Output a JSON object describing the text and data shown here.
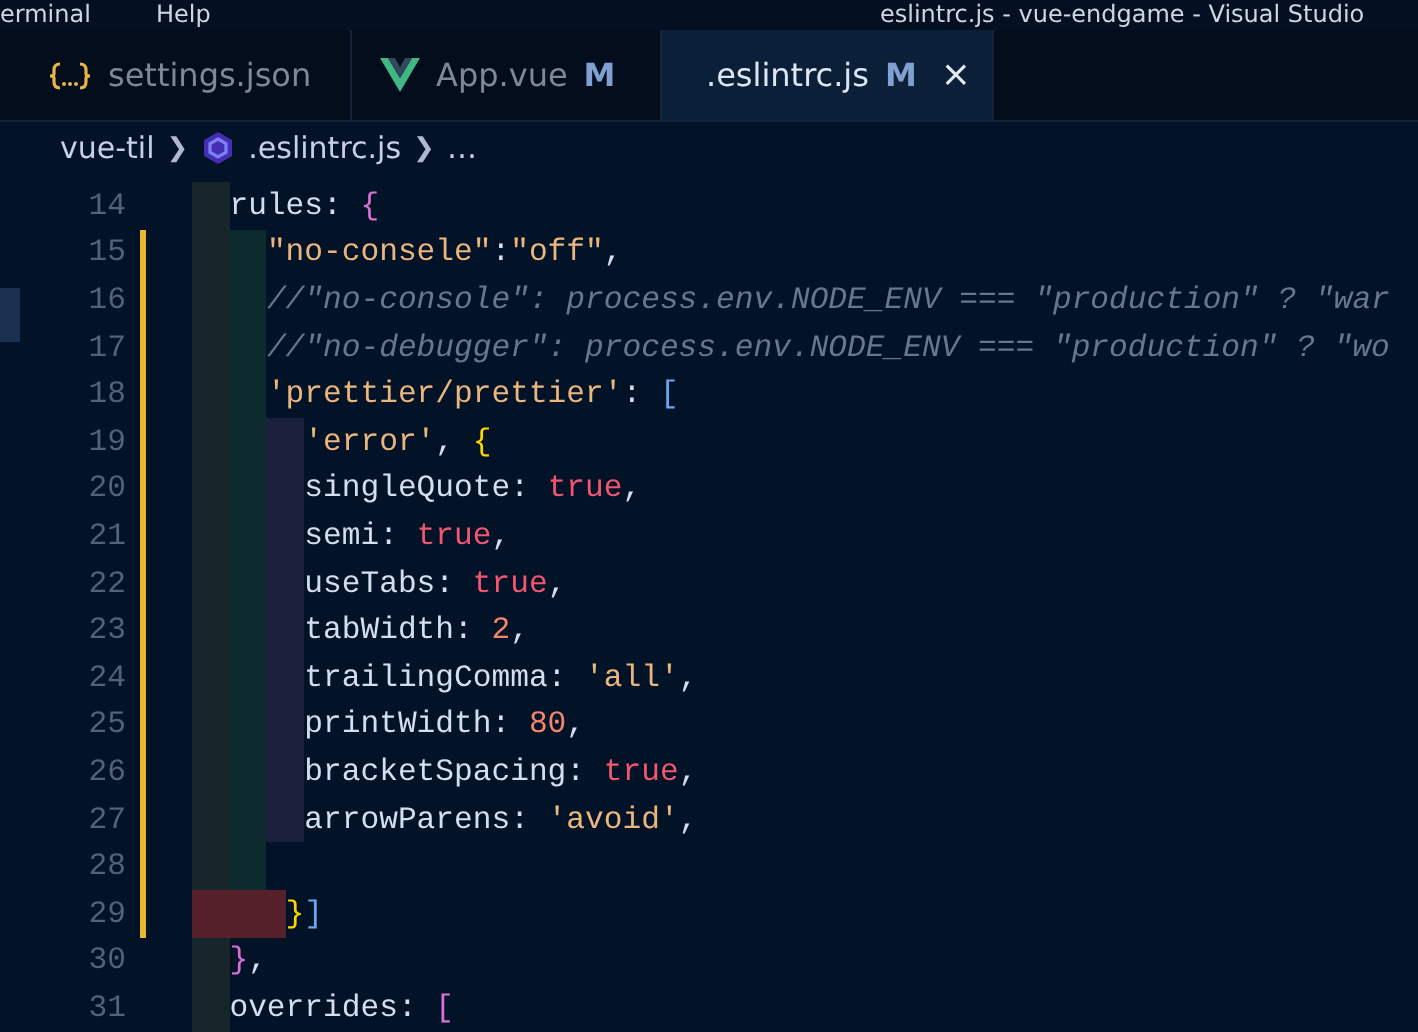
{
  "menu_bar": {
    "items": [
      "erminal",
      "Help"
    ],
    "window_title": "eslintrc.js - vue-endgame - Visual Studio"
  },
  "tabs": [
    {
      "label": "settings.json",
      "selected": false
    },
    {
      "label": "App.vue",
      "selected": false,
      "badge": "M"
    },
    {
      "label": ".eslintrc.js",
      "selected": true,
      "badge": "M",
      "close": "×"
    }
  ],
  "breadcrumb": [
    {
      "kind": "folder",
      "text": "vue-til"
    },
    {
      "kind": "separator",
      "text": "❯"
    },
    {
      "kind": "file",
      "text": ".eslintrc.js"
    },
    {
      "kind": "separator",
      "text": "❯"
    },
    {
      "kind": "more",
      "text": "…"
    }
  ],
  "lines": [
    {
      "number": "14",
      "modified": false,
      "indent_error": false,
      "tokens": [
        {
          "kind": "plain",
          "text": "  rules: "
        },
        {
          "kind": "brace1",
          "text": "{"
        }
      ]
    },
    {
      "number": "15",
      "modified": true,
      "indent_error": false,
      "tokens": [
        {
          "kind": "string",
          "text": "    \"no-consele\""
        },
        {
          "kind": "plain",
          "text": ":"
        },
        {
          "kind": "string",
          "text": "\"off\""
        },
        {
          "kind": "plain",
          "text": ","
        }
      ]
    },
    {
      "number": "16",
      "modified": true,
      "indent_error": false,
      "tokens": [
        {
          "kind": "comment",
          "text": "    //\"no-console\": process.env.NODE_ENV === \"production\" ? \"war"
        }
      ]
    },
    {
      "number": "17",
      "modified": true,
      "indent_error": false,
      "tokens": [
        {
          "kind": "comment",
          "text": "    //\"no-debugger\": process.env.NODE_ENV === \"production\" ? \"wo"
        }
      ]
    },
    {
      "number": "18",
      "modified": true,
      "indent_error": false,
      "tokens": [
        {
          "kind": "string",
          "text": "    'prettier/prettier'"
        },
        {
          "kind": "plain",
          "text": ": "
        },
        {
          "kind": "brace3",
          "text": "["
        }
      ]
    },
    {
      "number": "19",
      "modified": true,
      "indent_error": false,
      "tokens": [
        {
          "kind": "string",
          "text": "      'error'"
        },
        {
          "kind": "plain",
          "text": ", "
        },
        {
          "kind": "brace2",
          "text": "{"
        }
      ]
    },
    {
      "number": "20",
      "modified": true,
      "indent_error": false,
      "tokens": [
        {
          "kind": "plain",
          "text": "      singleQuote: "
        },
        {
          "kind": "bool",
          "text": "true"
        },
        {
          "kind": "plain",
          "text": ","
        }
      ]
    },
    {
      "number": "21",
      "modified": true,
      "indent_error": false,
      "tokens": [
        {
          "kind": "plain",
          "text": "      semi: "
        },
        {
          "kind": "bool",
          "text": "true"
        },
        {
          "kind": "plain",
          "text": ","
        }
      ]
    },
    {
      "number": "22",
      "modified": true,
      "indent_error": false,
      "tokens": [
        {
          "kind": "plain",
          "text": "      useTabs: "
        },
        {
          "kind": "bool",
          "text": "true"
        },
        {
          "kind": "plain",
          "text": ","
        }
      ]
    },
    {
      "number": "23",
      "modified": true,
      "indent_error": false,
      "tokens": [
        {
          "kind": "plain",
          "text": "      tabWidth: "
        },
        {
          "kind": "number",
          "text": "2"
        },
        {
          "kind": "plain",
          "text": ","
        }
      ]
    },
    {
      "number": "24",
      "modified": true,
      "indent_error": false,
      "tokens": [
        {
          "kind": "plain",
          "text": "      trailingComma: "
        },
        {
          "kind": "string",
          "text": "'all'"
        },
        {
          "kind": "plain",
          "text": ","
        }
      ]
    },
    {
      "number": "25",
      "modified": true,
      "indent_error": false,
      "tokens": [
        {
          "kind": "plain",
          "text": "      printWidth: "
        },
        {
          "kind": "number",
          "text": "80"
        },
        {
          "kind": "plain",
          "text": ","
        }
      ]
    },
    {
      "number": "26",
      "modified": true,
      "indent_error": false,
      "tokens": [
        {
          "kind": "plain",
          "text": "      bracketSpacing: "
        },
        {
          "kind": "bool",
          "text": "true"
        },
        {
          "kind": "plain",
          "text": ","
        }
      ]
    },
    {
      "number": "27",
      "modified": true,
      "indent_error": false,
      "tokens": [
        {
          "kind": "plain",
          "text": "      arrowParens: "
        },
        {
          "kind": "string",
          "text": "'avoid'"
        },
        {
          "kind": "plain",
          "text": ","
        }
      ]
    },
    {
      "number": "28",
      "modified": true,
      "indent_error": false
    },
    {
      "number": "29",
      "modified": true,
      "indent_error": true,
      "tokens": [
        {
          "kind": "brace2",
          "text": "     }"
        },
        {
          "kind": "brace3",
          "text": "]"
        }
      ]
    },
    {
      "number": "30",
      "modified": false,
      "indent_error": false,
      "tokens": [
        {
          "kind": "brace1",
          "text": "  }"
        },
        {
          "kind": "plain",
          "text": ","
        }
      ]
    },
    {
      "number": "31",
      "modified": false,
      "indent_error": false,
      "tokens": [
        {
          "kind": "plain",
          "text": "  overrides: "
        },
        {
          "kind": "brace1",
          "text": "["
        }
      ]
    }
  ]
}
